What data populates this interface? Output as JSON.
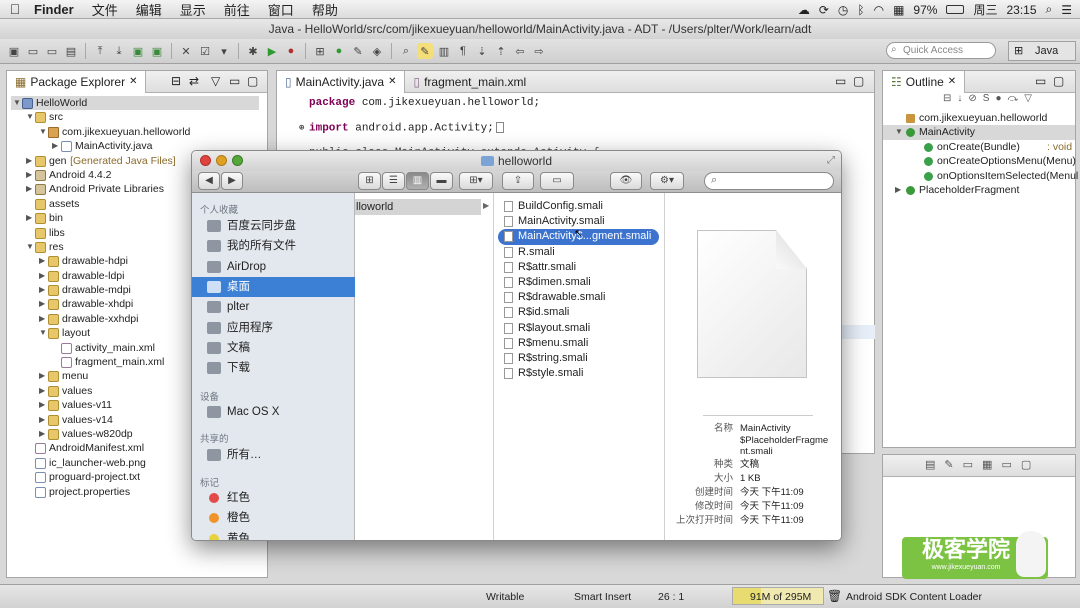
{
  "menubar": {
    "app_name": "Finder",
    "items": [
      "文件",
      "编辑",
      "显示",
      "前往",
      "窗口",
      "帮助"
    ],
    "battery": "97%",
    "day": "周三",
    "time": "23:15"
  },
  "window_title": "Java - HelloWorld/src/com/jikexueyuan/helloworld/MainActivity.java - ADT - /Users/plter/Work/learn/adt",
  "toolbar": {
    "quick_access_placeholder": "Quick Access",
    "perspective": "Java"
  },
  "package_explorer": {
    "tab": "Package Explorer",
    "items": [
      {
        "label": "HelloWorld",
        "suffix": ""
      },
      {
        "label": "src",
        "suffix": ""
      },
      {
        "label": "com.jikexueyuan.helloworld",
        "suffix": ""
      },
      {
        "label": "MainActivity.java",
        "suffix": ""
      },
      {
        "label": "gen",
        "suffix": "[Generated Java Files]"
      },
      {
        "label": "Android 4.4.2",
        "suffix": ""
      },
      {
        "label": "Android Private Libraries",
        "suffix": ""
      },
      {
        "label": "assets",
        "suffix": ""
      },
      {
        "label": "bin",
        "suffix": ""
      },
      {
        "label": "libs",
        "suffix": ""
      },
      {
        "label": "res",
        "suffix": ""
      },
      {
        "label": "drawable-hdpi",
        "suffix": ""
      },
      {
        "label": "drawable-ldpi",
        "suffix": ""
      },
      {
        "label": "drawable-mdpi",
        "suffix": ""
      },
      {
        "label": "drawable-xhdpi",
        "suffix": ""
      },
      {
        "label": "drawable-xxhdpi",
        "suffix": ""
      },
      {
        "label": "layout",
        "suffix": ""
      },
      {
        "label": "activity_main.xml",
        "suffix": ""
      },
      {
        "label": "fragment_main.xml",
        "suffix": ""
      },
      {
        "label": "menu",
        "suffix": ""
      },
      {
        "label": "values",
        "suffix": ""
      },
      {
        "label": "values-v11",
        "suffix": ""
      },
      {
        "label": "values-v14",
        "suffix": ""
      },
      {
        "label": "values-w820dp",
        "suffix": ""
      },
      {
        "label": "AndroidManifest.xml",
        "suffix": ""
      },
      {
        "label": "ic_launcher-web.png",
        "suffix": ""
      },
      {
        "label": "proguard-project.txt",
        "suffix": ""
      },
      {
        "label": "project.properties",
        "suffix": ""
      }
    ]
  },
  "editor": {
    "tabs": [
      "MainActivity.java",
      "fragment_main.xml"
    ],
    "line1_kw": "package",
    "line1": "com.jikexueyuan.helloworld;",
    "line2_kw": "import",
    "line2": "android.app.Activity;",
    "line3": "public class MainActivity extends Activity {"
  },
  "outline": {
    "tab": "Outline",
    "items": [
      {
        "label": "com.jikexueyuan.helloworld",
        "suffix": ""
      },
      {
        "label": "MainActivity",
        "suffix": ""
      },
      {
        "label": "onCreate(Bundle)",
        "suffix": ": void"
      },
      {
        "label": "onCreateOptionsMenu(Menu)",
        "suffix": ""
      },
      {
        "label": "onOptionsItemSelected(Menul",
        "suffix": ""
      },
      {
        "label": "PlaceholderFragment",
        "suffix": ""
      }
    ]
  },
  "finder": {
    "title": "helloworld",
    "search_placeholder": "",
    "sidebar": {
      "favorites_header": "个人收藏",
      "favorites": [
        "百度云同步盘",
        "我的所有文件",
        "AirDrop",
        "桌面",
        "plter",
        "应用程序",
        "文稿",
        "下载"
      ],
      "devices_header": "设备",
      "devices": [
        "Mac OS X"
      ],
      "shared_header": "共享的",
      "shared": [
        "所有…"
      ],
      "tags_header": "标记",
      "tags": [
        "红色",
        "橙色",
        "黄色"
      ],
      "tag_colors": [
        "#e34a4a",
        "#f0932b",
        "#e6d23a"
      ]
    },
    "col1": "lloworld",
    "files": [
      "BuildConfig.smali",
      "MainActivity.smali",
      "MainActivity$PlaceholderFragment.smali",
      "R.smali",
      "R$attr.smali",
      "R$dimen.smali",
      "R$drawable.smali",
      "R$id.smali",
      "R$layout.smali",
      "R$menu.smali",
      "R$string.smali",
      "R$style.smali"
    ],
    "selected_display": "MainActivity$...gment.smali",
    "info": {
      "name_label": "名称",
      "name": "MainActivity $PlaceholderFragme nt.smali",
      "kind_label": "种类",
      "kind": "文稿",
      "size_label": "大小",
      "size": "1 KB",
      "created_label": "创建时间",
      "created": "今天 下午11:09",
      "modified_label": "修改时间",
      "modified": "今天 下午11:09",
      "opened_label": "上次打开时间",
      "opened": "今天 下午11:09"
    }
  },
  "statusbar": {
    "writable": "Writable",
    "insert": "Smart Insert",
    "position": "26 : 1",
    "heap": "91M of 295M",
    "loader": "Android SDK Content Loader"
  },
  "watermark": {
    "title": "极客学院",
    "url": "www.jikexueyuan.com"
  },
  "colors": {
    "selection": "#3b73cf",
    "sidebar_selection": "#3b80d4",
    "keyword": "#7f0055"
  }
}
